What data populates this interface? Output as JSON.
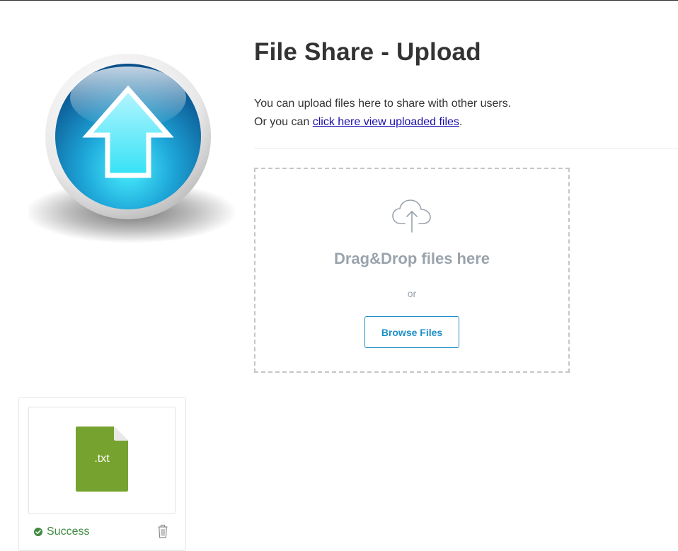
{
  "page": {
    "title": "File Share - Upload",
    "intro_line1": "You can upload files here to share with other users.",
    "intro_line2_prefix": "Or you can ",
    "intro_link": "click here view uploaded files",
    "intro_line2_suffix": "."
  },
  "dropzone": {
    "icon": "cloud-upload-icon",
    "title": "Drag&Drop files here",
    "or_text": "or",
    "browse_label": "Browse Files",
    "accent_color": "#1f8fc9"
  },
  "file": {
    "extension": ".txt",
    "icon_color": "#76a22f",
    "status": "Success",
    "status_icon": "check-circle-icon",
    "delete_icon": "trash-icon"
  },
  "colors": {
    "title": "#333333",
    "link": "#1a0dab",
    "muted": "#9aa3ac",
    "success": "#3f8a3f"
  }
}
